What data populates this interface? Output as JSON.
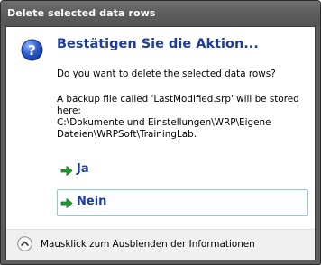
{
  "window": {
    "title": "Delete selected data rows"
  },
  "dialog": {
    "icon": "question-icon",
    "heading": "Bestätigen Sie die Aktion...",
    "question": "Do you want to delete the selected data rows?",
    "backup_lines": [
      "A backup file called 'LastModified.srp' will be stored",
      "here:",
      "C:\\Dokumente und Einstellungen\\WRP\\Eigene",
      "Dateien\\WRPSoft\\TrainingLab."
    ]
  },
  "commands": [
    {
      "label": "Ja",
      "icon": "green-arrow-icon",
      "focused": false
    },
    {
      "label": "Nein",
      "icon": "green-arrow-icon",
      "focused": true
    }
  ],
  "footer": {
    "icon": "chevron-up-icon",
    "text": "Mausklick zum Ausblenden der Informationen"
  },
  "colors": {
    "titlebar": "#5a5a5a",
    "heading": "#1e3c9a",
    "focus_border": "#8fc6e6",
    "arrow": "#1f9a2c",
    "footer_bg": "#f0f0f0"
  }
}
